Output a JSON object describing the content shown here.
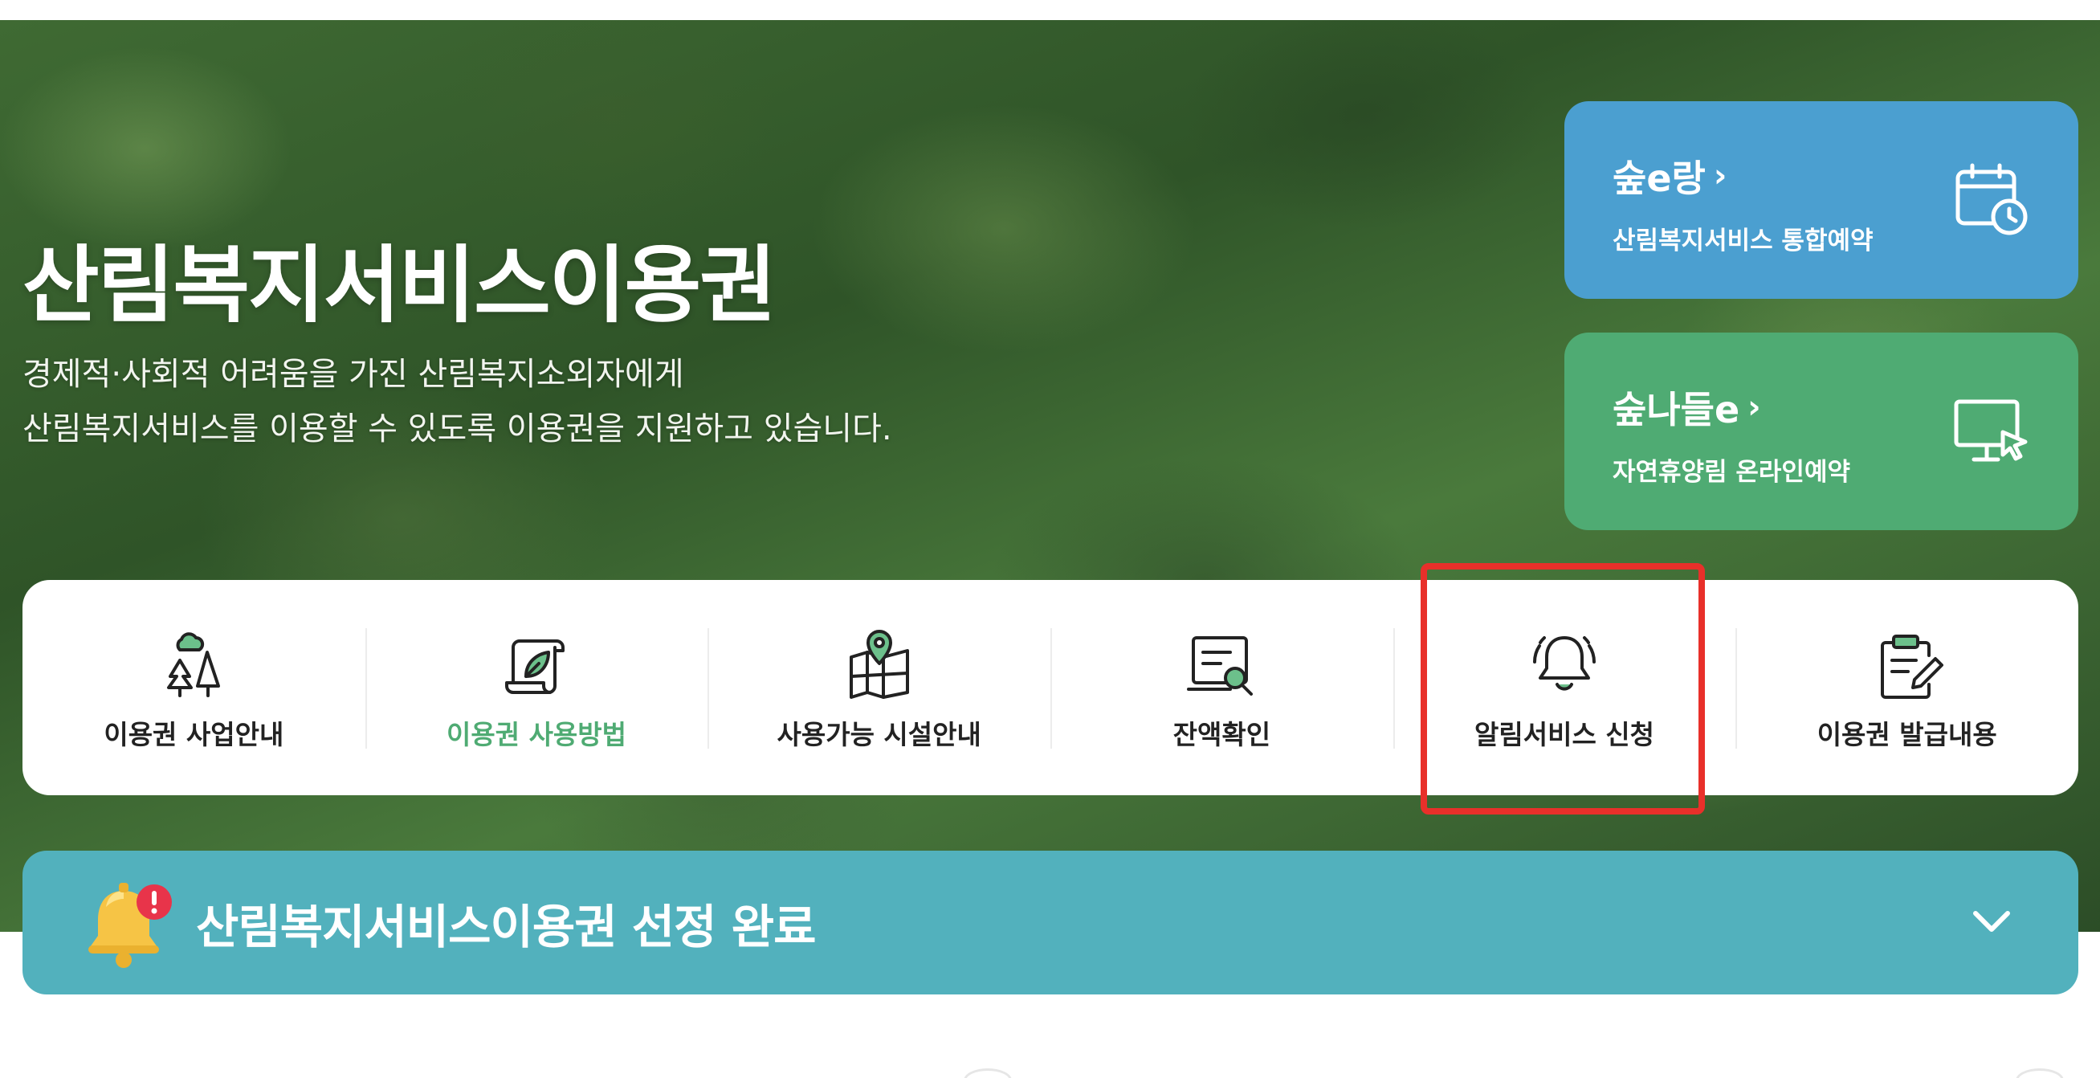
{
  "hero": {
    "title": "산림복지서비스이용권",
    "description_line1": "경제적·사회적 어려움을 가진 산림복지소외자에게",
    "description_line2": "산림복지서비스를 이용할 수 있도록 이용권을 지원하고 있습니다."
  },
  "quick_links": [
    {
      "title": "숲e랑",
      "subtitle": "산림복지서비스 통합예약",
      "icon": "calendar-clock-icon",
      "color": "#4b9fd0"
    },
    {
      "title": "숲나들e",
      "subtitle": "자연휴양림 온라인예약",
      "icon": "monitor-cursor-icon",
      "color": "#4fab73"
    }
  ],
  "menu": {
    "items": [
      {
        "label": "이용권 사업안내",
        "icon": "trees-icon",
        "active": false
      },
      {
        "label": "이용권 사용방법",
        "icon": "scroll-leaf-icon",
        "active": true
      },
      {
        "label": "사용가능 시설안내",
        "icon": "map-pin-icon",
        "active": false
      },
      {
        "label": "잔액확인",
        "icon": "search-document-icon",
        "active": false
      },
      {
        "label": "알림서비스 신청",
        "icon": "bell-ringing-icon",
        "active": false
      },
      {
        "label": "이용권 발급내용",
        "icon": "clipboard-edit-icon",
        "active": false
      }
    ],
    "active_color": "#4fab73",
    "highlight_color": "#e8302a"
  },
  "notice": {
    "text": "산림복지서비스이용권 선정 완료",
    "icon": "bell-alert-icon",
    "toggle_icon": "chevron-down-icon",
    "color": "#52b1bd"
  }
}
